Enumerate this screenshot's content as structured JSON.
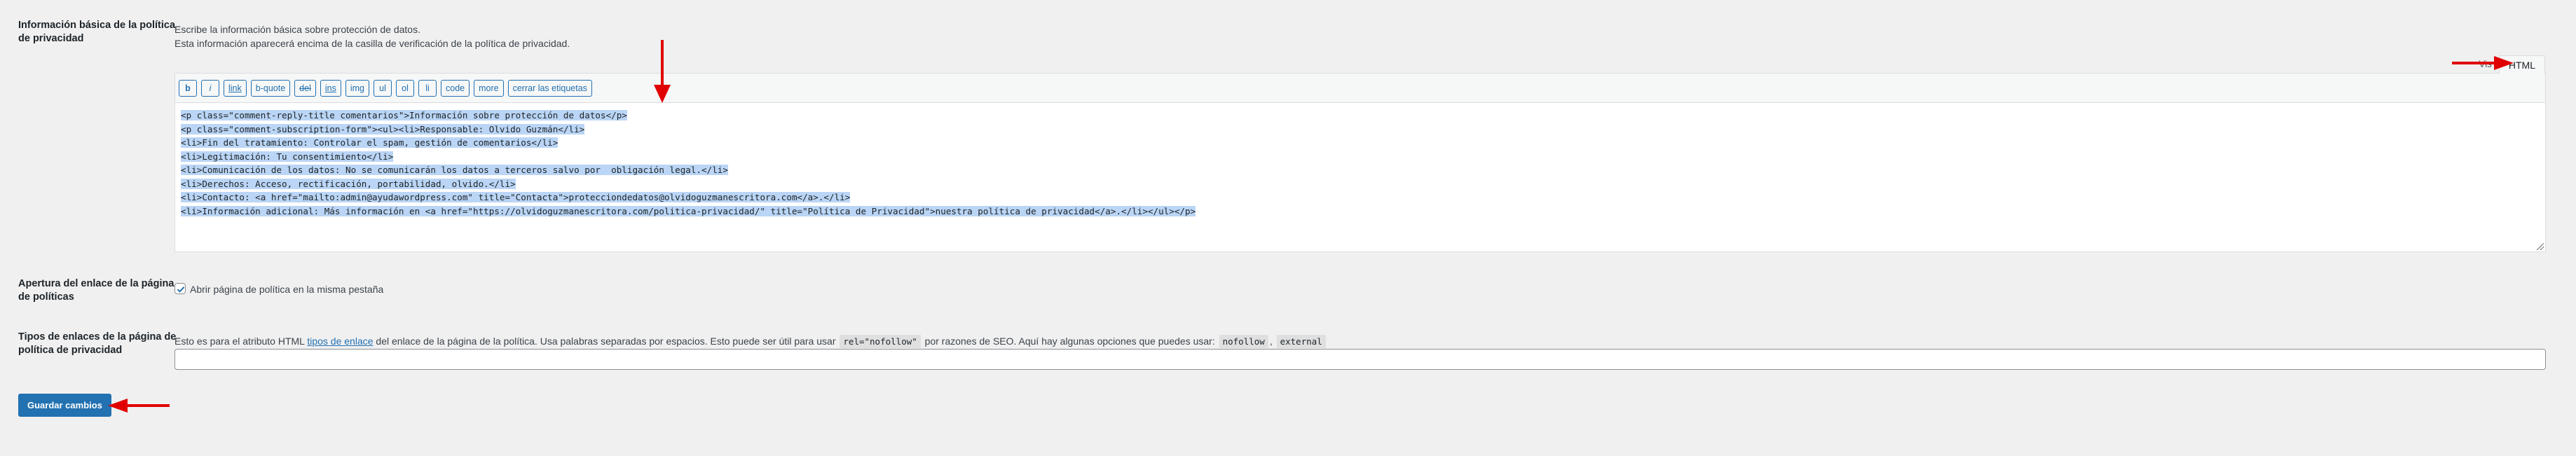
{
  "privacy_info": {
    "label": "Información básica de la política de privacidad",
    "desc_line1": "Escribe la información básica sobre protección de datos.",
    "desc_line2": "Esta información aparecerá encima de la casilla de verificación de la política de privacidad.",
    "tabs": {
      "visual": "Vis",
      "html": "HTML"
    },
    "toolbar": [
      "b",
      "i",
      "link",
      "b-quote",
      "del",
      "ins",
      "img",
      "ul",
      "ol",
      "li",
      "code",
      "more",
      "cerrar las etiquetas"
    ],
    "code_lines": [
      "<p class=\"comment-reply-title comentarios\">Información sobre protección de datos</p>",
      "<p class=\"comment-subscription-form\"><ul><li>Responsable: Olvido Guzmán</li>",
      "<li>Fin del tratamiento: Controlar el spam, gestión de comentarios</li>",
      "<li>Legitimación: Tu consentimiento</li>",
      "<li>Comunicación de los datos: No se comunicarán los datos a terceros salvo por  obligación legal.</li>",
      "<li>Derechos: Acceso, rectificación, portabilidad, olvido.</li>",
      "<li>Contacto: <a href=\"mailto:admin@ayudawordpress.com\" title=\"Contacta\">protecciondedatos@olvidoguzmanescritora.com</a>.</li>",
      "<li>Información adicional: Más información en <a href=\"https://olvidoguzmanescritora.com/politica-privacidad/\" title=\"Política de Privacidad\">nuestra política de privacidad</a>.</li></ul></p>"
    ]
  },
  "link_opening": {
    "label": "Apertura del enlace de la página de políticas",
    "checkbox_label": "Abrir página de política en la misma pestaña",
    "checked": true
  },
  "link_types": {
    "label": "Tipos de enlaces de la página de política de privacidad",
    "desc_before": "Esto es para el atributo HTML",
    "desc_link": "tipos de enlace",
    "desc_middle": "del enlace de la página de la política. Usa palabras separadas por espacios. Esto puede ser útil para usar",
    "code_rel": "rel=\"nofollow\"",
    "desc_after": "por razones de SEO. Aquí hay algunas opciones que puedes usar:",
    "code_nofollow": "nofollow",
    "separator": ",",
    "code_external": "external",
    "input_value": ""
  },
  "save_label": "Guardar cambios",
  "colors": {
    "accent": "#2271b1",
    "selection": "#bad5f5",
    "annotation_arrow": "#e00000",
    "background": "#f0f0f1"
  }
}
